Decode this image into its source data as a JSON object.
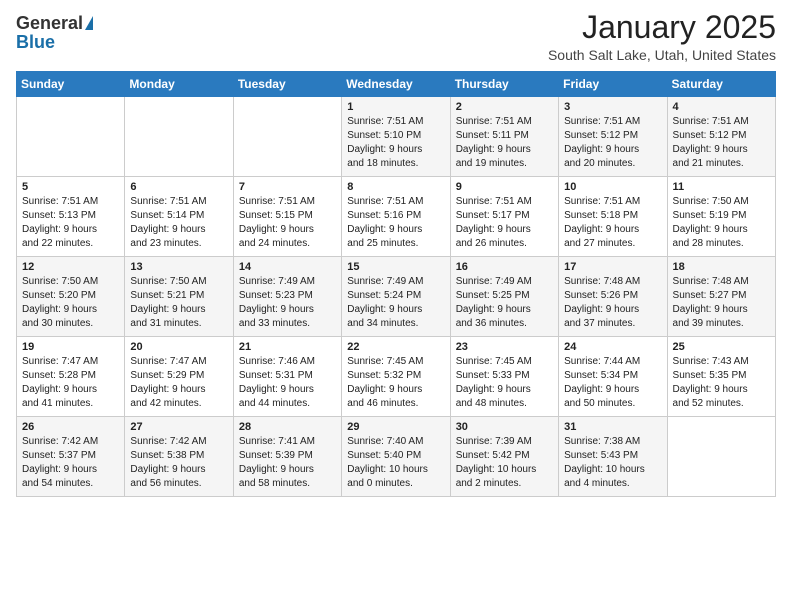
{
  "logo": {
    "general": "General",
    "blue": "Blue"
  },
  "title": "January 2025",
  "location": "South Salt Lake, Utah, United States",
  "days_of_week": [
    "Sunday",
    "Monday",
    "Tuesday",
    "Wednesday",
    "Thursday",
    "Friday",
    "Saturday"
  ],
  "weeks": [
    [
      {
        "day": "",
        "info": ""
      },
      {
        "day": "",
        "info": ""
      },
      {
        "day": "",
        "info": ""
      },
      {
        "day": "1",
        "info": "Sunrise: 7:51 AM\nSunset: 5:10 PM\nDaylight: 9 hours\nand 18 minutes."
      },
      {
        "day": "2",
        "info": "Sunrise: 7:51 AM\nSunset: 5:11 PM\nDaylight: 9 hours\nand 19 minutes."
      },
      {
        "day": "3",
        "info": "Sunrise: 7:51 AM\nSunset: 5:12 PM\nDaylight: 9 hours\nand 20 minutes."
      },
      {
        "day": "4",
        "info": "Sunrise: 7:51 AM\nSunset: 5:12 PM\nDaylight: 9 hours\nand 21 minutes."
      }
    ],
    [
      {
        "day": "5",
        "info": "Sunrise: 7:51 AM\nSunset: 5:13 PM\nDaylight: 9 hours\nand 22 minutes."
      },
      {
        "day": "6",
        "info": "Sunrise: 7:51 AM\nSunset: 5:14 PM\nDaylight: 9 hours\nand 23 minutes."
      },
      {
        "day": "7",
        "info": "Sunrise: 7:51 AM\nSunset: 5:15 PM\nDaylight: 9 hours\nand 24 minutes."
      },
      {
        "day": "8",
        "info": "Sunrise: 7:51 AM\nSunset: 5:16 PM\nDaylight: 9 hours\nand 25 minutes."
      },
      {
        "day": "9",
        "info": "Sunrise: 7:51 AM\nSunset: 5:17 PM\nDaylight: 9 hours\nand 26 minutes."
      },
      {
        "day": "10",
        "info": "Sunrise: 7:51 AM\nSunset: 5:18 PM\nDaylight: 9 hours\nand 27 minutes."
      },
      {
        "day": "11",
        "info": "Sunrise: 7:50 AM\nSunset: 5:19 PM\nDaylight: 9 hours\nand 28 minutes."
      }
    ],
    [
      {
        "day": "12",
        "info": "Sunrise: 7:50 AM\nSunset: 5:20 PM\nDaylight: 9 hours\nand 30 minutes."
      },
      {
        "day": "13",
        "info": "Sunrise: 7:50 AM\nSunset: 5:21 PM\nDaylight: 9 hours\nand 31 minutes."
      },
      {
        "day": "14",
        "info": "Sunrise: 7:49 AM\nSunset: 5:23 PM\nDaylight: 9 hours\nand 33 minutes."
      },
      {
        "day": "15",
        "info": "Sunrise: 7:49 AM\nSunset: 5:24 PM\nDaylight: 9 hours\nand 34 minutes."
      },
      {
        "day": "16",
        "info": "Sunrise: 7:49 AM\nSunset: 5:25 PM\nDaylight: 9 hours\nand 36 minutes."
      },
      {
        "day": "17",
        "info": "Sunrise: 7:48 AM\nSunset: 5:26 PM\nDaylight: 9 hours\nand 37 minutes."
      },
      {
        "day": "18",
        "info": "Sunrise: 7:48 AM\nSunset: 5:27 PM\nDaylight: 9 hours\nand 39 minutes."
      }
    ],
    [
      {
        "day": "19",
        "info": "Sunrise: 7:47 AM\nSunset: 5:28 PM\nDaylight: 9 hours\nand 41 minutes."
      },
      {
        "day": "20",
        "info": "Sunrise: 7:47 AM\nSunset: 5:29 PM\nDaylight: 9 hours\nand 42 minutes."
      },
      {
        "day": "21",
        "info": "Sunrise: 7:46 AM\nSunset: 5:31 PM\nDaylight: 9 hours\nand 44 minutes."
      },
      {
        "day": "22",
        "info": "Sunrise: 7:45 AM\nSunset: 5:32 PM\nDaylight: 9 hours\nand 46 minutes."
      },
      {
        "day": "23",
        "info": "Sunrise: 7:45 AM\nSunset: 5:33 PM\nDaylight: 9 hours\nand 48 minutes."
      },
      {
        "day": "24",
        "info": "Sunrise: 7:44 AM\nSunset: 5:34 PM\nDaylight: 9 hours\nand 50 minutes."
      },
      {
        "day": "25",
        "info": "Sunrise: 7:43 AM\nSunset: 5:35 PM\nDaylight: 9 hours\nand 52 minutes."
      }
    ],
    [
      {
        "day": "26",
        "info": "Sunrise: 7:42 AM\nSunset: 5:37 PM\nDaylight: 9 hours\nand 54 minutes."
      },
      {
        "day": "27",
        "info": "Sunrise: 7:42 AM\nSunset: 5:38 PM\nDaylight: 9 hours\nand 56 minutes."
      },
      {
        "day": "28",
        "info": "Sunrise: 7:41 AM\nSunset: 5:39 PM\nDaylight: 9 hours\nand 58 minutes."
      },
      {
        "day": "29",
        "info": "Sunrise: 7:40 AM\nSunset: 5:40 PM\nDaylight: 10 hours\nand 0 minutes."
      },
      {
        "day": "30",
        "info": "Sunrise: 7:39 AM\nSunset: 5:42 PM\nDaylight: 10 hours\nand 2 minutes."
      },
      {
        "day": "31",
        "info": "Sunrise: 7:38 AM\nSunset: 5:43 PM\nDaylight: 10 hours\nand 4 minutes."
      },
      {
        "day": "",
        "info": ""
      }
    ]
  ]
}
